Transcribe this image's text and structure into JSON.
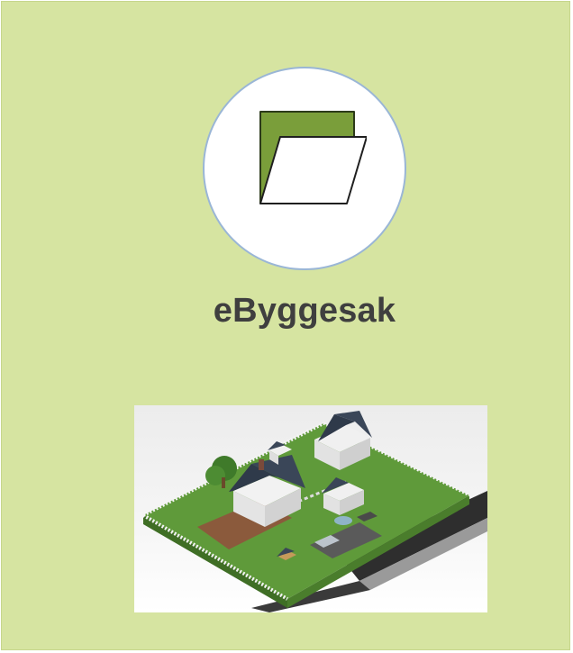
{
  "app": {
    "title": "eByggesak"
  },
  "icons": {
    "main": "folder-icon",
    "illustration": "house-property-illustration"
  },
  "colors": {
    "tile_background": "#d6e4a1",
    "title_text": "#3f3f3f",
    "circle_border": "#9ab6d6",
    "folder_green": "#7a9e3a"
  }
}
